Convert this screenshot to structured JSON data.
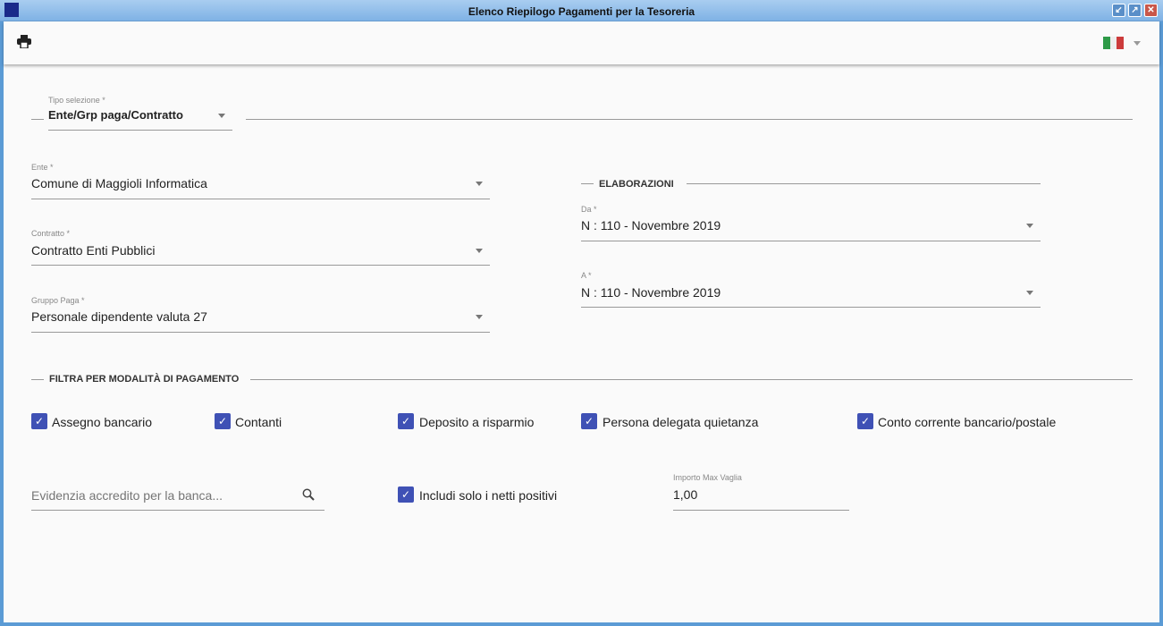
{
  "window": {
    "title": "Elenco Riepilogo Pagamenti per la Tesoreria",
    "restore_icon": "↙",
    "maximize_icon": "↗",
    "close_icon": "✕"
  },
  "toolbar": {
    "print_icon": "print-icon",
    "language": "it"
  },
  "tipo_selezione": {
    "label": "Tipo selezione *",
    "value": "Ente/Grp paga/Contratto"
  },
  "ente": {
    "label": "Ente *",
    "value": "Comune di Maggioli Informatica"
  },
  "contratto": {
    "label": "Contratto *",
    "value": "Contratto Enti Pubblici"
  },
  "gruppo_paga": {
    "label": "Gruppo Paga *",
    "value": "Personale dipendente valuta 27"
  },
  "elaborazioni": {
    "title": "ELABORAZIONI",
    "da_label": "Da *",
    "da_value": "N : 110 - Novembre 2019",
    "a_label": "A *",
    "a_value": "N : 110 - Novembre 2019"
  },
  "filtra": {
    "title": "FILTRA PER MODALITÀ DI PAGAMENTO",
    "options": [
      {
        "label": "Assegno bancario",
        "checked": true
      },
      {
        "label": "Contanti",
        "checked": true
      },
      {
        "label": "Deposito a risparmio",
        "checked": true
      },
      {
        "label": "Persona delegata quietanza",
        "checked": true
      },
      {
        "label": "Conto corrente bancario/postale",
        "checked": true
      }
    ]
  },
  "banca": {
    "placeholder": "Evidenzia accredito per la banca..."
  },
  "netti": {
    "label": "Includi solo i netti positivi",
    "checked": true
  },
  "importo": {
    "label": "Importo Max Vaglia",
    "value": "1,00"
  },
  "check_glyph": "✓"
}
